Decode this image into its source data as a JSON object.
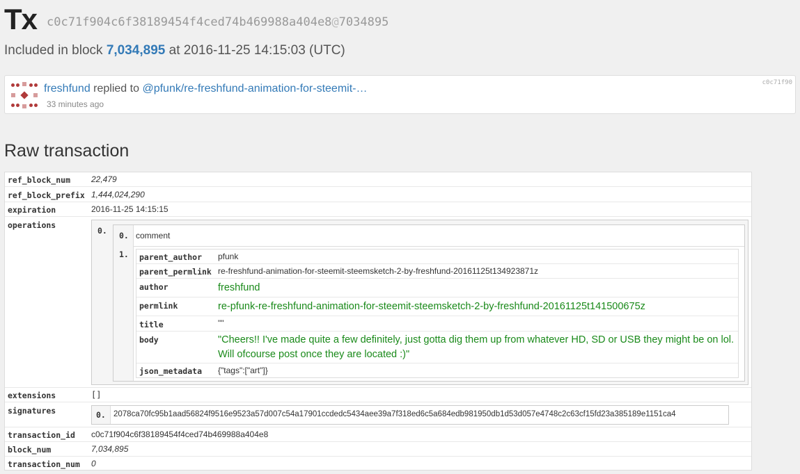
{
  "header": {
    "title": "Tx",
    "hash": "c0c71f904c6f38189454f4ced74b469988a404e8",
    "at": "@",
    "hash_suffix": "7034895"
  },
  "included": {
    "prefix": "Included in block",
    "block": "7,034,895",
    "middle": "at 2016-11-25 14:15:03 (UTC)"
  },
  "card": {
    "author": "freshfund",
    "verb": "replied to",
    "target": "@pfunk/re-freshfund-animation-for-steemit-…",
    "time": "33 minutes ago",
    "id": "c0c71f90"
  },
  "raw": {
    "title": "Raw transaction",
    "ref_block_num": {
      "key": "ref_block_num",
      "value": "22,479"
    },
    "ref_block_prefix": {
      "key": "ref_block_prefix",
      "value": "1,444,024,290"
    },
    "expiration": {
      "key": "expiration",
      "value": "2016-11-25 14:15:15"
    },
    "operations": {
      "key": "operations",
      "index": "0.",
      "type_index": "0.",
      "type": "comment",
      "body_index": "1.",
      "fields": {
        "parent_author": {
          "key": "parent_author",
          "value": "pfunk"
        },
        "parent_permlink": {
          "key": "parent_permlink",
          "value": "re-freshfund-animation-for-steemit-steemsketch-2-by-freshfund-20161125t134923871z"
        },
        "author": {
          "key": "author",
          "value": "freshfund"
        },
        "permlink": {
          "key": "permlink",
          "value": "re-pfunk-re-freshfund-animation-for-steemit-steemsketch-2-by-freshfund-20161125t141500675z"
        },
        "title": {
          "key": "title",
          "value": "\"\""
        },
        "body": {
          "key": "body",
          "line1": "\"Cheers!! I've made quite a few definitely, just gotta dig them up from whatever HD, SD or USB they might be on lol.",
          "line2": "Will ofcourse post once they are located :)\""
        },
        "json_metadata": {
          "key": "json_metadata",
          "value": "{\"tags\":[\"art\"]}"
        }
      }
    },
    "extensions": {
      "key": "extensions",
      "value": "[]"
    },
    "signatures": {
      "key": "signatures",
      "index": "0.",
      "value": "2078ca70fc95b1aad56824f9516e9523a57d007c54a17901ccdedc5434aee39a7f318ed6c5a684edb981950db1d53d057e4748c2c63cf15fd23a385189e1151ca4"
    },
    "transaction_id": {
      "key": "transaction_id",
      "value": "c0c71f904c6f38189454f4ced74b469988a404e8"
    },
    "block_num": {
      "key": "block_num",
      "value": "7,034,895"
    },
    "transaction_num": {
      "key": "transaction_num",
      "value": "0"
    }
  },
  "colors": {
    "link": "#337ab7",
    "green_value": "#1a8a1a",
    "avatar": "#b03a3a"
  },
  "icons": {
    "avatar": "identicon-avatar"
  }
}
